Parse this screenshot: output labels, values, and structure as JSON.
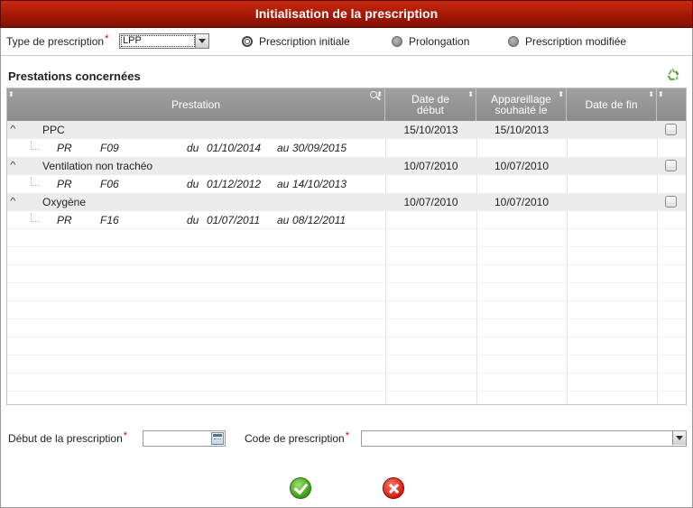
{
  "window": {
    "title": "Initialisation de la prescription"
  },
  "type_prescription": {
    "label": "Type de prescription",
    "required_mark": "*",
    "value": "LPP",
    "radios": [
      {
        "label": "Prescription initiale",
        "checked": true
      },
      {
        "label": "Prolongation",
        "checked": false
      },
      {
        "label": "Prescription modifiée",
        "checked": false
      }
    ]
  },
  "section": {
    "title": "Prestations concernées",
    "refresh_icon": "recycle-icon"
  },
  "grid": {
    "columns": [
      "Prestation",
      "Date de début",
      "Appareillage souhaité le",
      "Date de fin"
    ],
    "rows": [
      {
        "name": "PPC",
        "date_debut": "15/10/2013",
        "appareillage": "15/10/2013",
        "date_fin": "",
        "detail": {
          "code1": "PR",
          "code2": "F09",
          "du_label": "du",
          "du": "01/10/2014",
          "au_label": "au",
          "au": "30/09/2015"
        }
      },
      {
        "name": "Ventilation non trachéo",
        "date_debut": "10/07/2010",
        "appareillage": "10/07/2010",
        "date_fin": "",
        "detail": {
          "code1": "PR",
          "code2": "F06",
          "du_label": "du",
          "du": "01/12/2012",
          "au_label": "au",
          "au": "14/10/2013"
        }
      },
      {
        "name": "Oxygène",
        "date_debut": "10/07/2010",
        "appareillage": "10/07/2010",
        "date_fin": "",
        "detail": {
          "code1": "PR",
          "code2": "F16",
          "du_label": "du",
          "du": "01/07/2011",
          "au_label": "au",
          "au": "08/12/2011"
        }
      }
    ]
  },
  "form": {
    "debut_label": "Début de la prescription",
    "debut_value": "",
    "code_label": "Code de prescription",
    "code_value": "",
    "required_mark": "*"
  },
  "actions": {
    "ok_icon": "check-icon",
    "cancel_icon": "close-icon"
  }
}
